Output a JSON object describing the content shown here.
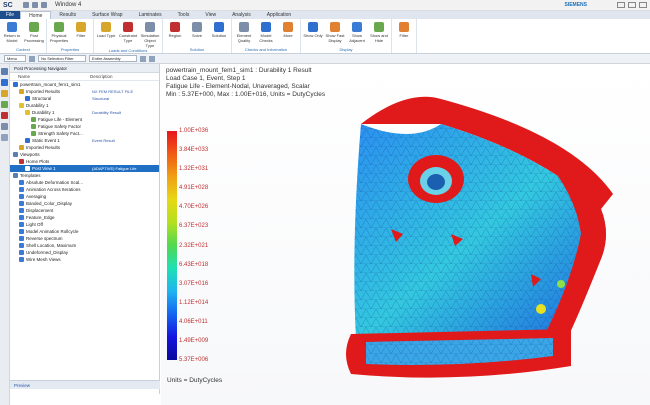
{
  "app": {
    "logo": "SC",
    "window_title": "Window 4",
    "brand": "SIEMENS"
  },
  "tabs": [
    "File",
    "Home",
    "Results",
    "Surface Wrap",
    "Laminates",
    "Tools",
    "View",
    "Analysis",
    "Application"
  ],
  "ribbon": {
    "groups": [
      {
        "name": "Context",
        "buttons": [
          "Return to Model",
          "Post Processing"
        ]
      },
      {
        "name": "Properties",
        "buttons": [
          "Physical Properties",
          "Filter"
        ]
      },
      {
        "name": "Loads and Conditions",
        "buttons": [
          "Load Type",
          "Constraint Type",
          "Simulation Object Type"
        ]
      },
      {
        "name": "Solution",
        "buttons": [
          "Region",
          "Solve",
          "Solution"
        ]
      },
      {
        "name": "Checks and Information",
        "buttons": [
          "Element Quality",
          "Model Checks",
          "More"
        ]
      },
      {
        "name": "Display",
        "buttons": [
          "Show Only",
          "Show Fast Display",
          "Show Adjacent",
          "Show and Hide"
        ]
      },
      {
        "name": "",
        "buttons": [
          "Filter"
        ]
      }
    ]
  },
  "selection": {
    "menu": "Menu",
    "filter": "No Selection Filter",
    "scope": "Entire Assembly"
  },
  "navigator": {
    "title": "Post Processing Navigator",
    "col_name": "Name",
    "col_desc": "Description",
    "rows": [
      {
        "indent": 0,
        "label": "powertrain_mount_fem1_sim1",
        "desc": "",
        "color": "#2f6fd0"
      },
      {
        "indent": 1,
        "label": "Imported Results",
        "desc": "NX FEM RESULT FILE",
        "color": "#d6a72a"
      },
      {
        "indent": 2,
        "label": "Structural",
        "desc": "Structural",
        "color": "#2f6fd0"
      },
      {
        "indent": 1,
        "label": "Durability 1",
        "desc": "",
        "color": "#e0c030"
      },
      {
        "indent": 2,
        "label": "Durability 1",
        "desc": "Durability Result",
        "color": "#e0c030"
      },
      {
        "indent": 3,
        "label": "Fatigue Life - Element",
        "desc": "",
        "color": "#6aa84f"
      },
      {
        "indent": 3,
        "label": "Fatigue Safety Factor",
        "desc": "",
        "color": "#6aa84f"
      },
      {
        "indent": 3,
        "label": "Strength Safety Fact...",
        "desc": "",
        "color": "#6aa84f"
      },
      {
        "indent": 2,
        "label": "Static Event 1",
        "desc": "Event Result",
        "color": "#2f6fd0"
      },
      {
        "indent": 1,
        "label": "Imported Results",
        "desc": "",
        "color": "#d6a72a"
      },
      {
        "indent": 0,
        "label": "Viewports",
        "desc": "",
        "color": "#5b7fb0"
      },
      {
        "indent": 1,
        "label": "Home Plots",
        "desc": "",
        "color": "#c03030"
      },
      {
        "indent": 2,
        "label": "Post View 1",
        "desc": "(ADAPTIVE) Fatigue Life",
        "color": "#ffffff",
        "selected": true
      },
      {
        "indent": 0,
        "label": "Templates",
        "desc": "",
        "color": "#5b7fb0"
      },
      {
        "indent": 1,
        "label": "Absolute Deformation Scal...",
        "desc": "",
        "color": "#3a7bd5"
      },
      {
        "indent": 1,
        "label": "Animation Across Iterations",
        "desc": "",
        "color": "#3a7bd5"
      },
      {
        "indent": 1,
        "label": "Averaging",
        "desc": "",
        "color": "#3a7bd5"
      },
      {
        "indent": 1,
        "label": "Banded_Color_Display",
        "desc": "",
        "color": "#3a7bd5"
      },
      {
        "indent": 1,
        "label": "Displacement",
        "desc": "",
        "color": "#3a7bd5"
      },
      {
        "indent": 1,
        "label": "Feature_Edge",
        "desc": "",
        "color": "#3a7bd5"
      },
      {
        "indent": 1,
        "label": "Light Off",
        "desc": "",
        "color": "#3a7bd5"
      },
      {
        "indent": 1,
        "label": "Model Animation Rollcycle",
        "desc": "",
        "color": "#3a7bd5"
      },
      {
        "indent": 1,
        "label": "Reverse spectrum",
        "desc": "",
        "color": "#3a7bd5"
      },
      {
        "indent": 1,
        "label": "Shell Location, Maximum",
        "desc": "",
        "color": "#3a7bd5"
      },
      {
        "indent": 1,
        "label": "Undeformed_Display",
        "desc": "",
        "color": "#3a7bd5"
      },
      {
        "indent": 1,
        "label": "Wire Mesh Views",
        "desc": "",
        "color": "#3a7bd5"
      }
    ],
    "footer": "Preview"
  },
  "viewport": {
    "header_lines": [
      "powertrain_mount_fem1_sim1 : Durability 1 Result",
      "Load Case 1, Event, Step 1",
      "Fatigue Life - Element-Nodal, Unaveraged, Scalar",
      "Min : 5.37E+000, Max : 1.00E+016, Units = DutyCycles"
    ],
    "legend": [
      "1.00E+036",
      "3.84E+033",
      "1.32E+031",
      "4.91E+028",
      "4.70E+026",
      "6.37E+023",
      "2.32E+021",
      "6.43E+018",
      "3.07E+016",
      "1.12E+014",
      "4.06E+011",
      "1.49E+009",
      "5.37E+006"
    ],
    "units": "Units = DutyCycles"
  }
}
